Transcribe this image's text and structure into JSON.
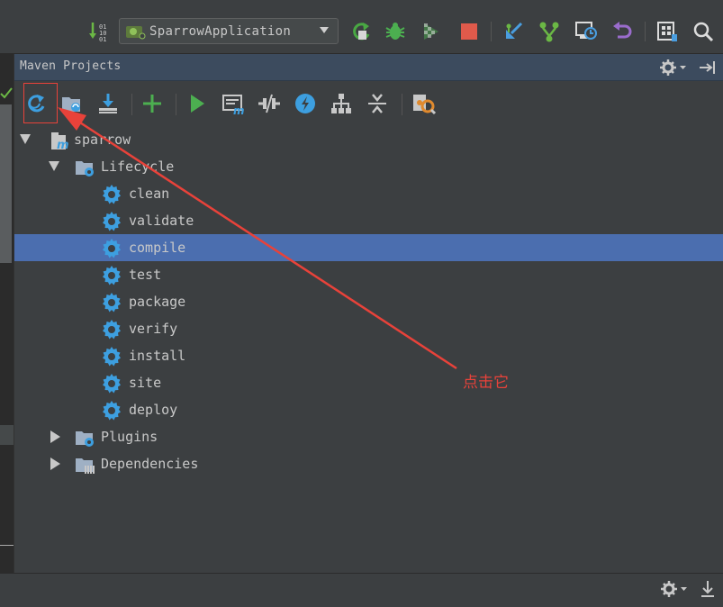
{
  "toolbar": {
    "run_configuration": "SparrowApplication",
    "icons": [
      "build-sort-icon",
      "run-config-icon",
      "rerun-icon",
      "debug-icon",
      "coverage-icon",
      "stop-icon",
      "vcs-update-icon",
      "vcs-commit-icon",
      "vcs-compare-icon",
      "vcs-revert-icon",
      "project-structure-icon",
      "search-icon"
    ]
  },
  "panel": {
    "title": "Maven Projects"
  },
  "maven_toolbar": {
    "icons": [
      "reimport-icon",
      "generate-sources-icon",
      "download-icon",
      "add-icon",
      "run-goal-icon",
      "execute-goal-icon",
      "toggle-offline-icon",
      "skip-tests-icon",
      "show-dependencies-icon",
      "collapse-all-icon",
      "settings-icon"
    ]
  },
  "tree": {
    "project": "sparrow",
    "lifecycle_label": "Lifecycle",
    "lifecycle": [
      "clean",
      "validate",
      "compile",
      "test",
      "package",
      "verify",
      "install",
      "site",
      "deploy"
    ],
    "selected": "compile",
    "plugins_label": "Plugins",
    "dependencies_label": "Dependencies"
  },
  "annotation": {
    "text": "点击它",
    "color": "#e8423a"
  },
  "colors": {
    "background": "#3c3f41",
    "header": "#3c4b5e",
    "selection": "#4b6eaf",
    "gear_blue": "#3d9fe0"
  }
}
